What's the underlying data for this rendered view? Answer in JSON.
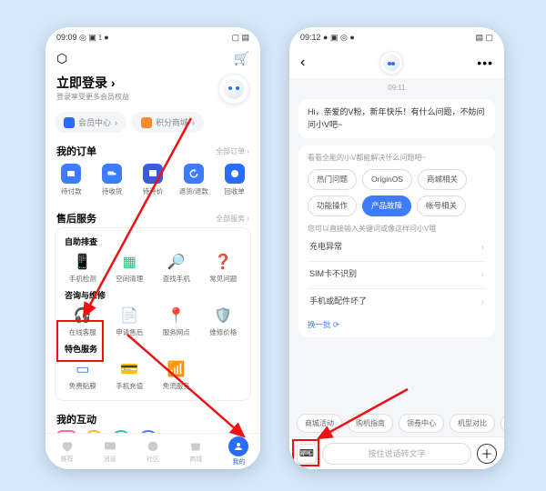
{
  "left": {
    "status": {
      "time": "09:09",
      "icons": "◎ ▣ ⟟ ●",
      "right": "▢ ▤"
    },
    "login": {
      "title": "立即登录",
      "arrow": "›",
      "sub": "登录享受更多会员权益"
    },
    "pills": {
      "member": "会员中心",
      "points": "积分商城",
      "chev": "›"
    },
    "orders": {
      "title": "我的订单",
      "more": "全部订单 ›",
      "items": [
        "待付款",
        "待收货",
        "待评价",
        "退货/退款",
        "回收单"
      ]
    },
    "service": {
      "title": "售后服务",
      "more": "全部服务 ›",
      "g1_label": "自助排查",
      "g1": [
        "手机检测",
        "空间清理",
        "查找手机",
        "常见问题"
      ],
      "g2_label": "咨询与维修",
      "g2": [
        "在线客服",
        "申请售后",
        "服务网点",
        "维修价格"
      ],
      "g3_label": "特色服务",
      "g3": [
        "免费贴膜",
        "手机充值",
        "免流服务"
      ]
    },
    "interact": {
      "title": "我的互动"
    },
    "nav": [
      "推荐",
      "消息",
      "社区",
      "商城",
      "我的"
    ]
  },
  "right": {
    "status": {
      "time": "09:12",
      "icons": "● ▣ ◎ ●",
      "right": "▤ ▢"
    },
    "ts": "09:11",
    "greeting": "Hi，亲爱的V粉，新年快乐！有什么问题，不妨问问小V吧~",
    "hint1": "看看全能的小V都能解决什么问题吧~",
    "chips": [
      "热门问题",
      "OriginOS",
      "商城相关",
      "功能操作",
      "产品故障",
      "帐号相关"
    ],
    "hint2": "您可以直接输入关键词或像这样问小V哦",
    "list": [
      "充电异常",
      "SIM卡不识别",
      "手机或配件坏了"
    ],
    "refresh": "换一批 ⟳",
    "suggest": [
      "商城活动",
      "购机指南",
      "领券中心",
      "机型对比",
      "以"
    ],
    "input": {
      "placeholder": "按住说话转文字"
    }
  }
}
